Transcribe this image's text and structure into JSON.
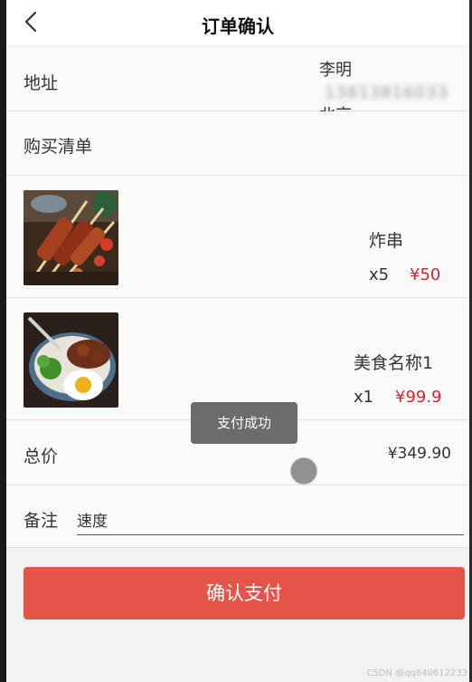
{
  "header": {
    "title": "订单确认"
  },
  "address": {
    "label": "地址",
    "name": "李明",
    "phone": "13813816033",
    "city": "北京"
  },
  "buylist": {
    "label": "购买清单"
  },
  "items": [
    {
      "name": "炸串",
      "qty": "x5",
      "price": "¥50",
      "image": "kebab-skewers"
    },
    {
      "name": "美食名称1",
      "qty": "x1",
      "price": "¥99.9",
      "image": "rice-bowl-egg"
    }
  ],
  "total": {
    "label": "总价",
    "value": "¥349.90"
  },
  "remark": {
    "label": "备注",
    "value": "速度"
  },
  "pay_button": {
    "label": "确认支付"
  },
  "toast": {
    "text": "支付成功"
  },
  "watermark": "CSDN @qq840612233",
  "colors": {
    "accent": "#e45448",
    "price": "#d7252f",
    "toast_bg": "#5f5f5f"
  }
}
